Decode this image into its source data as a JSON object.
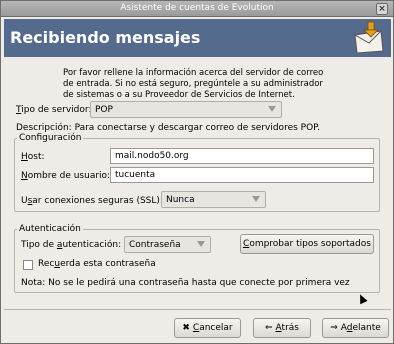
{
  "window": {
    "title": "Asistente de cuentas de Evolution",
    "close_glyph": "×"
  },
  "header": {
    "title": "Recibiendo mensajes",
    "icon": "mail-receive-icon"
  },
  "intro": {
    "line1": "Por favor rellene la información acerca del servidor de correo",
    "line2": "de entrada. Si no está seguro, pregúntele a su administrador",
    "line3": "de sistemas o a su Proveedor de Servicios de Internet."
  },
  "server_type": {
    "label_u": "T",
    "label_rest": "ipo de servidor:",
    "value": "POP"
  },
  "description": "Descripción: Para conectarse y descargar correo de servidores POP.",
  "config": {
    "legend": "Configuración",
    "host_label_u": "H",
    "host_label_rest": "ost:",
    "host_value": "mail.nodo50.org",
    "user_label_u": "N",
    "user_label_rest": "ombre de usuario:",
    "user_value": "tucuenta",
    "ssl_label_pre": "U",
    "ssl_label_u": "s",
    "ssl_label_rest": "ar conexiones seguras (SSL):",
    "ssl_value": "Nunca"
  },
  "auth": {
    "legend": "Autenticación",
    "type_label_pre": "Tipo de ",
    "type_label_u": "a",
    "type_label_rest": "utenticación:",
    "type_value": "Contraseña",
    "check_button_pre": "",
    "check_button_u": "C",
    "check_button_rest": "omprobar tipos soportados",
    "remember_pre": "Rec",
    "remember_u": "u",
    "remember_rest": "erda esta contraseña",
    "remember_checked": false,
    "note": "Nota: No se le pedirá una contraseña hasta que conecte por primera vez"
  },
  "buttons": {
    "cancel_u": "C",
    "cancel_rest": "ancelar",
    "back_u": "A",
    "back_rest": "trás",
    "forward_pre": "A",
    "forward_u": "d",
    "forward_rest": "elante"
  }
}
